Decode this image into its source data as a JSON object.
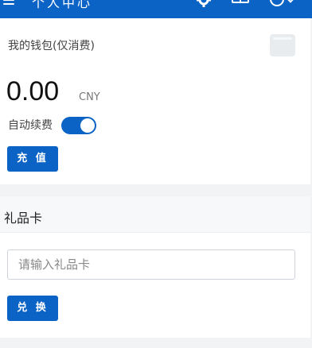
{
  "header": {
    "title": "个人中心",
    "icons": [
      "menu-icon",
      "gear-icon",
      "grid-icon",
      "user-icon",
      "chevron-down-icon"
    ]
  },
  "wallet": {
    "title": "我的钱包(仅消费)",
    "balance": "0.00",
    "currency": "CNY",
    "auto_renew_label": "自动续费",
    "auto_renew_on": true,
    "recharge_label": "充 值"
  },
  "gift_card": {
    "title": "礼品卡",
    "input_placeholder": "请输入礼品卡",
    "input_value": "",
    "redeem_label": "兑 换"
  },
  "colors": {
    "accent": "#0b63c6",
    "background": "#f1f3f5",
    "card": "#ffffff"
  }
}
